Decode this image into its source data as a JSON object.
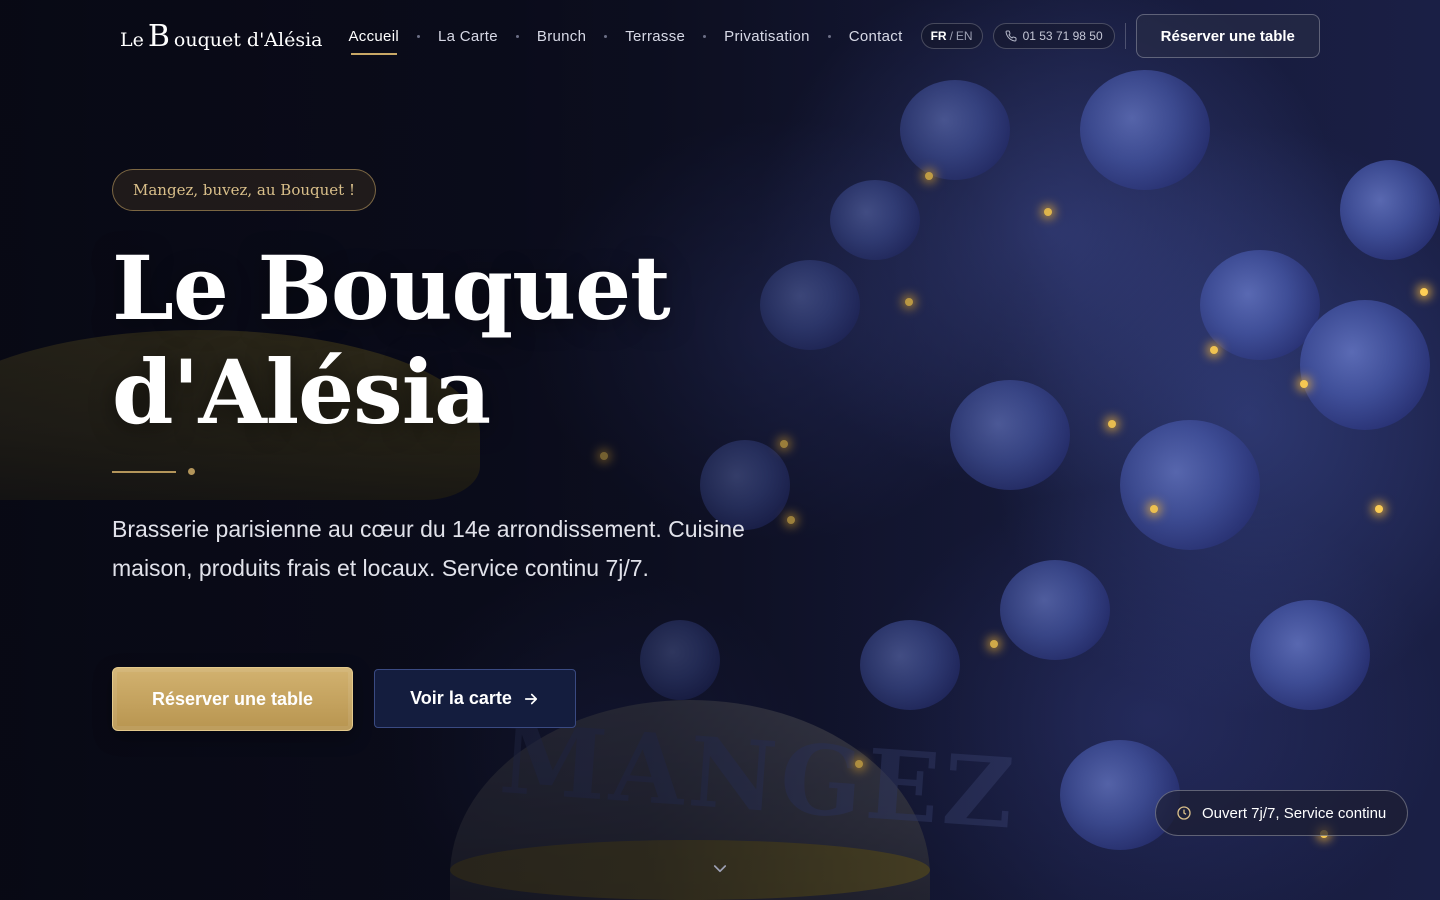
{
  "header": {
    "logo": {
      "prefix": "Le",
      "initial": "B",
      "rest": "ouquet d'Alésia"
    },
    "nav": [
      {
        "label": "Accueil",
        "active": true
      },
      {
        "label": "La Carte",
        "active": false
      },
      {
        "label": "Brunch",
        "active": false
      },
      {
        "label": "Terrasse",
        "active": false
      },
      {
        "label": "Privatisation",
        "active": false
      },
      {
        "label": "Contact",
        "active": false
      }
    ],
    "lang": {
      "current": "FR",
      "separator": "/",
      "other": "EN"
    },
    "phone": {
      "icon": "phone-icon",
      "number": "01 53 71 98 50"
    },
    "cta_label": "Réserver une table"
  },
  "hero": {
    "tagline": "Mangez, buvez, au Bouquet !",
    "title_line1": "Le Bouquet",
    "title_line2": "d'Alésia",
    "subtitle": "Brasserie parisienne au cœur du 14e arrondissement. Cuisine maison, produits frais et locaux. Service continu 7j/7.",
    "primary_button": "Réserver une table",
    "secondary_button": "Voir la carte",
    "secondary_icon": "arrow-right-icon",
    "scroll_icon": "chevron-down-icon"
  },
  "status": {
    "icon": "clock-icon",
    "text": "Ouvert 7j/7, Service continu"
  },
  "colors": {
    "accent_gold": "#c9a866",
    "button_gold": "#c4a25f",
    "navy_button": "#141d3e",
    "background": "#0b0d1c"
  }
}
